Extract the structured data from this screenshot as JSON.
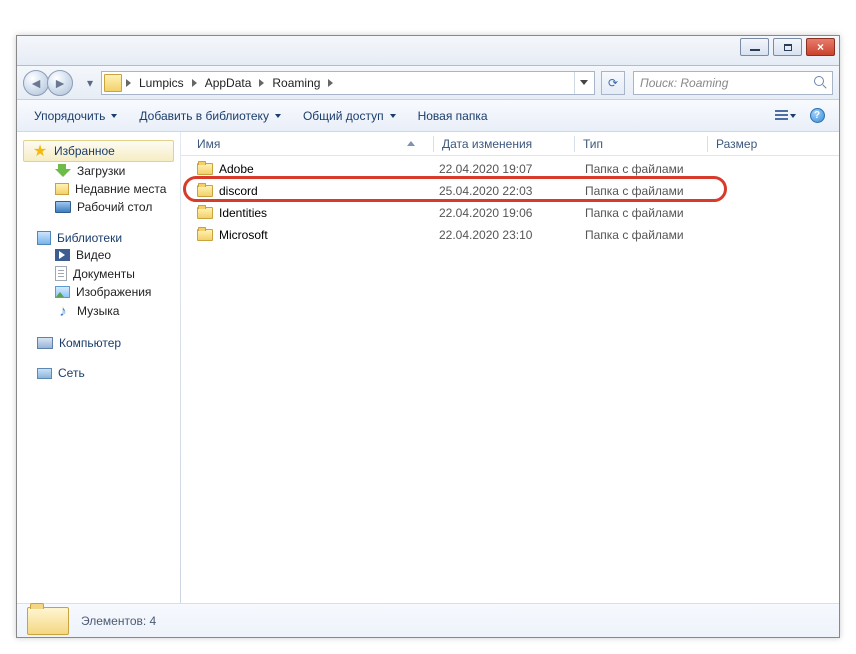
{
  "window": {
    "breadcrumbs": [
      "Lumpics",
      "AppData",
      "Roaming"
    ],
    "search_placeholder": "Поиск: Roaming"
  },
  "toolbar": {
    "organize": "Упорядочить",
    "include": "Добавить в библиотеку",
    "share": "Общий доступ",
    "newfolder": "Новая папка"
  },
  "columns": {
    "name": "Имя",
    "modified": "Дата изменения",
    "type": "Тип",
    "size": "Размер"
  },
  "sidebar": {
    "favorites": {
      "label": "Избранное",
      "items": [
        {
          "label": "Загрузки",
          "icon": "downloads"
        },
        {
          "label": "Недавние места",
          "icon": "recent"
        },
        {
          "label": "Рабочий стол",
          "icon": "desktop"
        }
      ]
    },
    "libraries": {
      "label": "Библиотеки",
      "items": [
        {
          "label": "Видео",
          "icon": "video"
        },
        {
          "label": "Документы",
          "icon": "doc"
        },
        {
          "label": "Изображения",
          "icon": "image"
        },
        {
          "label": "Музыка",
          "icon": "music"
        }
      ]
    },
    "computer": {
      "label": "Компьютер"
    },
    "network": {
      "label": "Сеть"
    }
  },
  "files": [
    {
      "name": "Adobe",
      "modified": "22.04.2020 19:07",
      "type": "Папка с файлами",
      "highlighted": false
    },
    {
      "name": "discord",
      "modified": "25.04.2020 22:03",
      "type": "Папка с файлами",
      "highlighted": true
    },
    {
      "name": "Identities",
      "modified": "22.04.2020 19:06",
      "type": "Папка с файлами",
      "highlighted": false
    },
    {
      "name": "Microsoft",
      "modified": "22.04.2020 23:10",
      "type": "Папка с файлами",
      "highlighted": false
    }
  ],
  "status": {
    "count_label": "Элементов: 4"
  }
}
